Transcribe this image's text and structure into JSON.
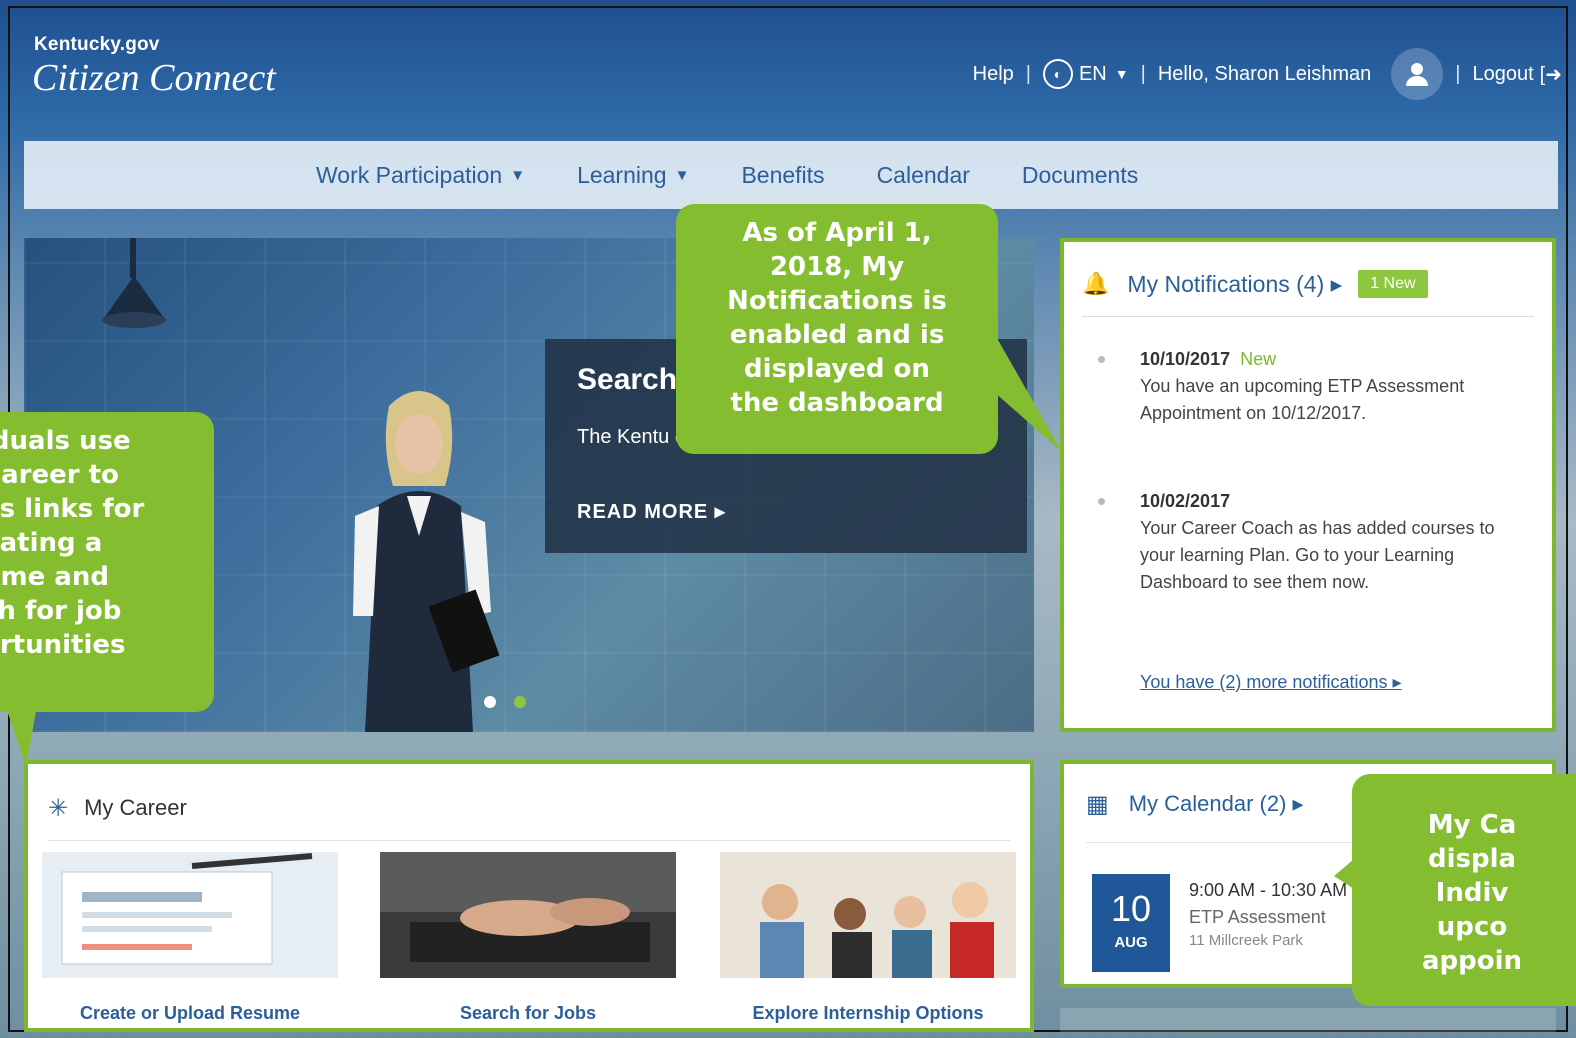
{
  "header": {
    "logo_line1": "Kentucky.gov",
    "logo_line2": "Citizen Connect",
    "help": "Help",
    "language": "EN",
    "greeting": "Hello, Sharon Leishman",
    "logout": "Logout"
  },
  "nav": {
    "items": [
      "Work Participation",
      "Learning",
      "Benefits",
      "Calendar",
      "Documents"
    ]
  },
  "hero": {
    "title": "Search",
    "description": "The Kentu one-stop solution for job seekers.",
    "read_more": "READ MORE ▸"
  },
  "notifications": {
    "title": "My Notifications (4) ▸",
    "badge": "1 New",
    "items": [
      {
        "date": "10/10/2017",
        "tag": "New",
        "message": "You have an upcoming ETP Assessment Appointment on 10/12/2017."
      },
      {
        "date": "10/02/2017",
        "tag": "",
        "message": "Your Career Coach as has added courses to your learning Plan. Go to your Learning Dashboard to see them now."
      }
    ],
    "more_link": "You have (2) more notifications ▸"
  },
  "career": {
    "title": "My Career",
    "tiles": [
      "Create or Upload Resume",
      "Search for Jobs",
      "Explore Internship Options"
    ]
  },
  "calendar": {
    "title": "My Calendar (2) ▸",
    "appointment": {
      "day": "10",
      "month": "AUG",
      "time": "9:00 AM - 10:30 AM",
      "name": "ETP Assessment",
      "location": "11 Millcreek Park"
    }
  },
  "callouts": {
    "notifications": [
      "As of April 1,",
      "2018, My",
      "Notifications is",
      "enabled and is",
      "displayed on",
      "the dashboard"
    ],
    "career": [
      "iduals use",
      "Career to",
      "es links for",
      "eating a",
      "ume and",
      "ch for job",
      "ortunities"
    ],
    "calendar": [
      "My Ca",
      "displa",
      "Indiv",
      "upco",
      "appoin"
    ]
  },
  "colors": {
    "accent": "#2b5f9a",
    "callout": "#84bd2f",
    "frame": "#7cb82f",
    "date_box": "#1f5799"
  }
}
